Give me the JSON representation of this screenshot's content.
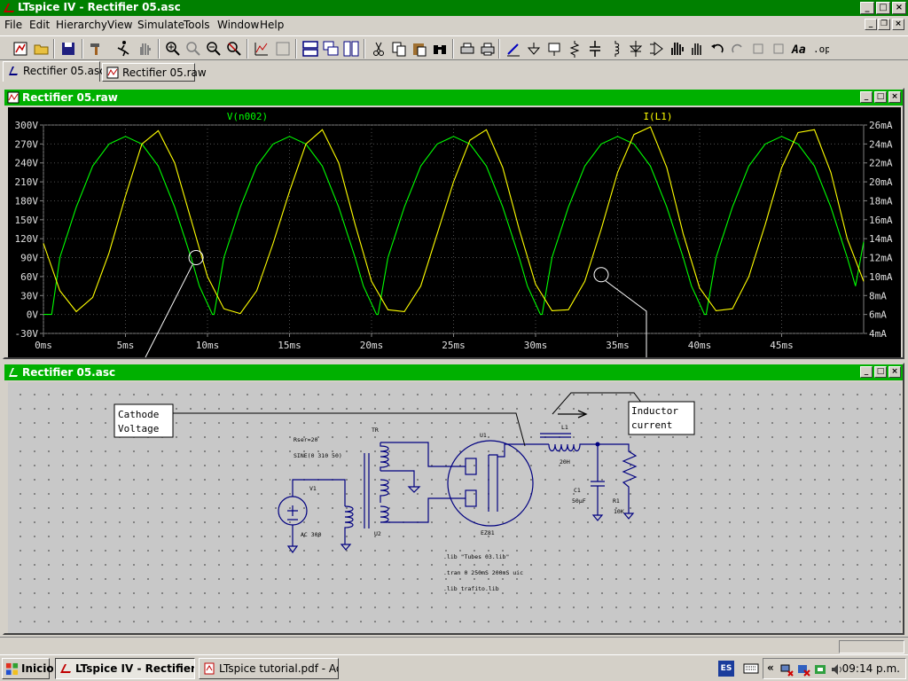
{
  "window": {
    "title": "LTspice IV - Rectifier 05.asc"
  },
  "menu": [
    "File",
    "Edit",
    "Hierarchy",
    "View",
    "Simulate",
    "Tools",
    "Window",
    "Help"
  ],
  "tabs": [
    {
      "label": "Rectifier 05.asc"
    },
    {
      "label": "Rectifier 05.raw"
    }
  ],
  "plot_pane": {
    "title": "Rectifier 05.raw"
  },
  "schematic_pane": {
    "title": "Rectifier 05.asc"
  },
  "chart_data": {
    "type": "line",
    "xlim": [
      0,
      50
    ],
    "xticks": [
      0,
      5,
      10,
      15,
      20,
      25,
      30,
      35,
      40,
      45
    ],
    "xtick_labels": [
      "0ms",
      "5ms",
      "10ms",
      "15ms",
      "20ms",
      "25ms",
      "30ms",
      "35ms",
      "40ms",
      "45ms"
    ],
    "left_axis": {
      "ylim": [
        -30,
        300
      ],
      "ticks": [
        -30,
        0,
        30,
        60,
        90,
        120,
        150,
        180,
        210,
        240,
        270,
        300
      ],
      "tick_labels": [
        "-30V",
        "0V",
        "30V",
        "60V",
        "90V",
        "120V",
        "150V",
        "180V",
        "210V",
        "240V",
        "270V",
        "300V"
      ]
    },
    "right_axis": {
      "ylim": [
        4,
        26
      ],
      "ticks": [
        4,
        6,
        8,
        10,
        12,
        14,
        16,
        18,
        20,
        22,
        24,
        26
      ],
      "tick_labels": [
        "4mA",
        "6mA",
        "8mA",
        "10mA",
        "12mA",
        "14mA",
        "16mA",
        "18mA",
        "20mA",
        "22mA",
        "24mA",
        "26mA"
      ]
    },
    "series": [
      {
        "name": "V(n002)",
        "color": "#00ff00",
        "axis": "left",
        "x": [
          0,
          0.5,
          1,
          2,
          3,
          4,
          5,
          6,
          7,
          8,
          9,
          9.5,
          10.3,
          10.4,
          11,
          12,
          13,
          14,
          15,
          16,
          17,
          18,
          19,
          19.5,
          20.3,
          20.4,
          21,
          22,
          23,
          24,
          25,
          26,
          27,
          28,
          29,
          29.5,
          30.3,
          30.4,
          31,
          32,
          33,
          34,
          35,
          36,
          37,
          38,
          39,
          39.5,
          40.3,
          40.4,
          41,
          42,
          43,
          44,
          45,
          46,
          47,
          48,
          49,
          49.5,
          50
        ],
        "y": [
          0,
          0,
          90,
          170,
          235,
          270,
          282,
          270,
          235,
          170,
          90,
          45,
          0,
          0,
          90,
          170,
          235,
          270,
          282,
          270,
          235,
          170,
          90,
          45,
          0,
          0,
          90,
          170,
          235,
          270,
          282,
          270,
          235,
          170,
          90,
          45,
          0,
          0,
          90,
          170,
          235,
          270,
          282,
          270,
          235,
          170,
          90,
          45,
          0,
          0,
          90,
          170,
          235,
          270,
          282,
          270,
          235,
          170,
          90,
          45,
          115
        ]
      },
      {
        "name": "I(L1)",
        "color": "#ffff00",
        "axis": "right",
        "x": [
          0,
          1,
          2,
          3,
          4,
          5,
          6,
          7,
          8,
          9,
          10,
          11,
          12,
          13,
          14,
          15,
          16,
          17,
          18,
          19,
          20,
          21,
          22,
          23,
          24,
          25,
          26,
          27,
          28,
          29,
          30,
          31,
          32,
          33,
          34,
          35,
          36,
          37,
          38,
          39,
          40,
          41,
          42,
          43,
          44,
          45,
          46,
          47,
          48,
          49,
          50
        ],
        "y": [
          13.5,
          8.5,
          6.3,
          7.8,
          12.5,
          18.5,
          24,
          25.4,
          22,
          16,
          10,
          6.6,
          6.1,
          8.5,
          13.5,
          19,
          24,
          25.5,
          22,
          15.5,
          9.5,
          6.5,
          6.3,
          9,
          14.5,
          20,
          24.4,
          25.5,
          21.5,
          15,
          9.2,
          6.4,
          6.5,
          9.5,
          15,
          21,
          25,
          25.8,
          21.5,
          14.5,
          8.8,
          6.4,
          6.6,
          10,
          15.5,
          21.5,
          25.2,
          25.5,
          21,
          14,
          9.5
        ]
      }
    ]
  },
  "schematic": {
    "annotation_cathode": [
      "Cathode",
      "Voltage"
    ],
    "annotation_inductor": [
      "Inductor",
      "current"
    ],
    "texts": {
      "rser": "Rser=20",
      "sine": "SINE(0 310 50)",
      "v1": "V1",
      "ac": "AC 300",
      "tr": "TR",
      "u2": "U2",
      "u1": "U1",
      "tube": "EZ81",
      "l1": "L1",
      "l1_val": "20H",
      "c1": "C1",
      "c1_val": "50µF",
      "r1": "R1",
      "r1_val": "10K",
      "lib1": ".lib \"Tubes 03.lib\"",
      "tran": ".tran 0 250mS 200mS uic",
      "lib2": ".lib trafito.lib"
    }
  },
  "taskbar": {
    "start": "Inicio",
    "buttons": [
      "LTspice IV - Rectifier ...",
      "LTspice tutorial.pdf - Ad..."
    ],
    "lang": "ES",
    "clock": "09:14 p.m."
  },
  "colors": {
    "title": "#008000",
    "pane_caption": "#00b000",
    "schematic_wire": "#000080"
  }
}
